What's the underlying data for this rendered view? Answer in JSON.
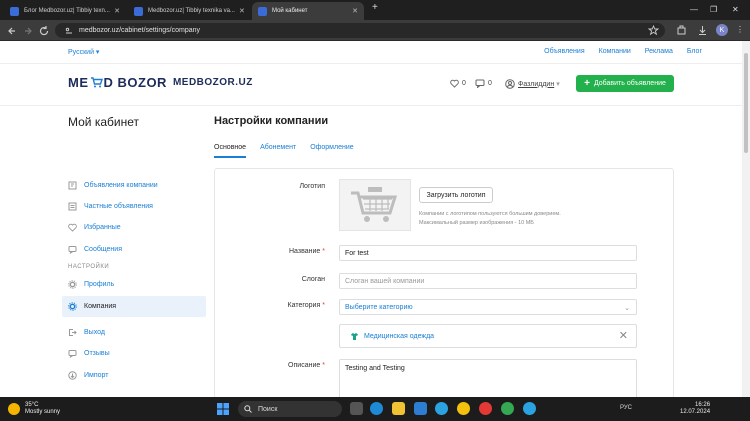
{
  "browser": {
    "tabs": [
      {
        "title": "Блог Medbozor.uz| Tibbiy texn..."
      },
      {
        "title": "Medbozor.uz| Tibbiy texnika va..."
      },
      {
        "title": "Мой кабинет"
      }
    ],
    "url": "medbozor.uz/cabinet/settings/company",
    "profile_initial": "K"
  },
  "topnav": {
    "language": "Русский",
    "links": [
      "Объявления",
      "Компании",
      "Реклама",
      "Блог"
    ]
  },
  "header": {
    "logo_left": "ME",
    "logo_right": "D BOZOR",
    "site_name": "MEDBOZOR.UZ",
    "favorites_count": "0",
    "messages_count": "0",
    "username": "Фазлиддин",
    "add_button": "Добавить объявление"
  },
  "sidebar": {
    "title": "Мой кабинет",
    "items": [
      {
        "label": "Объявления компании",
        "icon": "megaphone-icon"
      },
      {
        "label": "Частные объявления",
        "icon": "list-icon"
      },
      {
        "label": "Избранные",
        "icon": "heart-icon"
      },
      {
        "label": "Сообщения",
        "icon": "message-icon"
      }
    ],
    "section": "НАСТРОЙКИ",
    "settings_items": [
      {
        "label": "Профиль",
        "icon": "gear-icon"
      },
      {
        "label": "Компания",
        "icon": "gear-icon"
      }
    ],
    "bottom_items": [
      {
        "label": "Выход",
        "icon": "logout-icon"
      },
      {
        "label": "Отзывы",
        "icon": "chat-icon"
      },
      {
        "label": "Импорт",
        "icon": "download-icon"
      }
    ]
  },
  "main": {
    "title": "Настройки компании",
    "tabs": [
      {
        "label": "Основное"
      },
      {
        "label": "Абонемент"
      },
      {
        "label": "Оформление"
      }
    ],
    "form": {
      "logo_label": "Логотип",
      "upload_button": "Загрузить логотип",
      "hint_1": "Компании с логотипом пользуются большим доверием.",
      "hint_2": "Максимальный размер изображения - 10 МБ",
      "name_label": "Название",
      "name_value": "For test",
      "slogan_label": "Слоган",
      "slogan_placeholder": "Слоган вашей компании",
      "category_label": "Категория",
      "category_placeholder": "Выберите категорию",
      "category_chip": "Медицинская одежда",
      "description_label": "Описание",
      "description_value": "Testing and Testing"
    }
  },
  "taskbar": {
    "temperature": "35°C",
    "weather": "Mostly sunny",
    "search": "Поиск",
    "language": "РУС",
    "time": "16:26",
    "date": "12.07.2024"
  },
  "colors": {
    "accent": "#1a7fd4",
    "success": "#23b14d",
    "required": "#e53935"
  }
}
